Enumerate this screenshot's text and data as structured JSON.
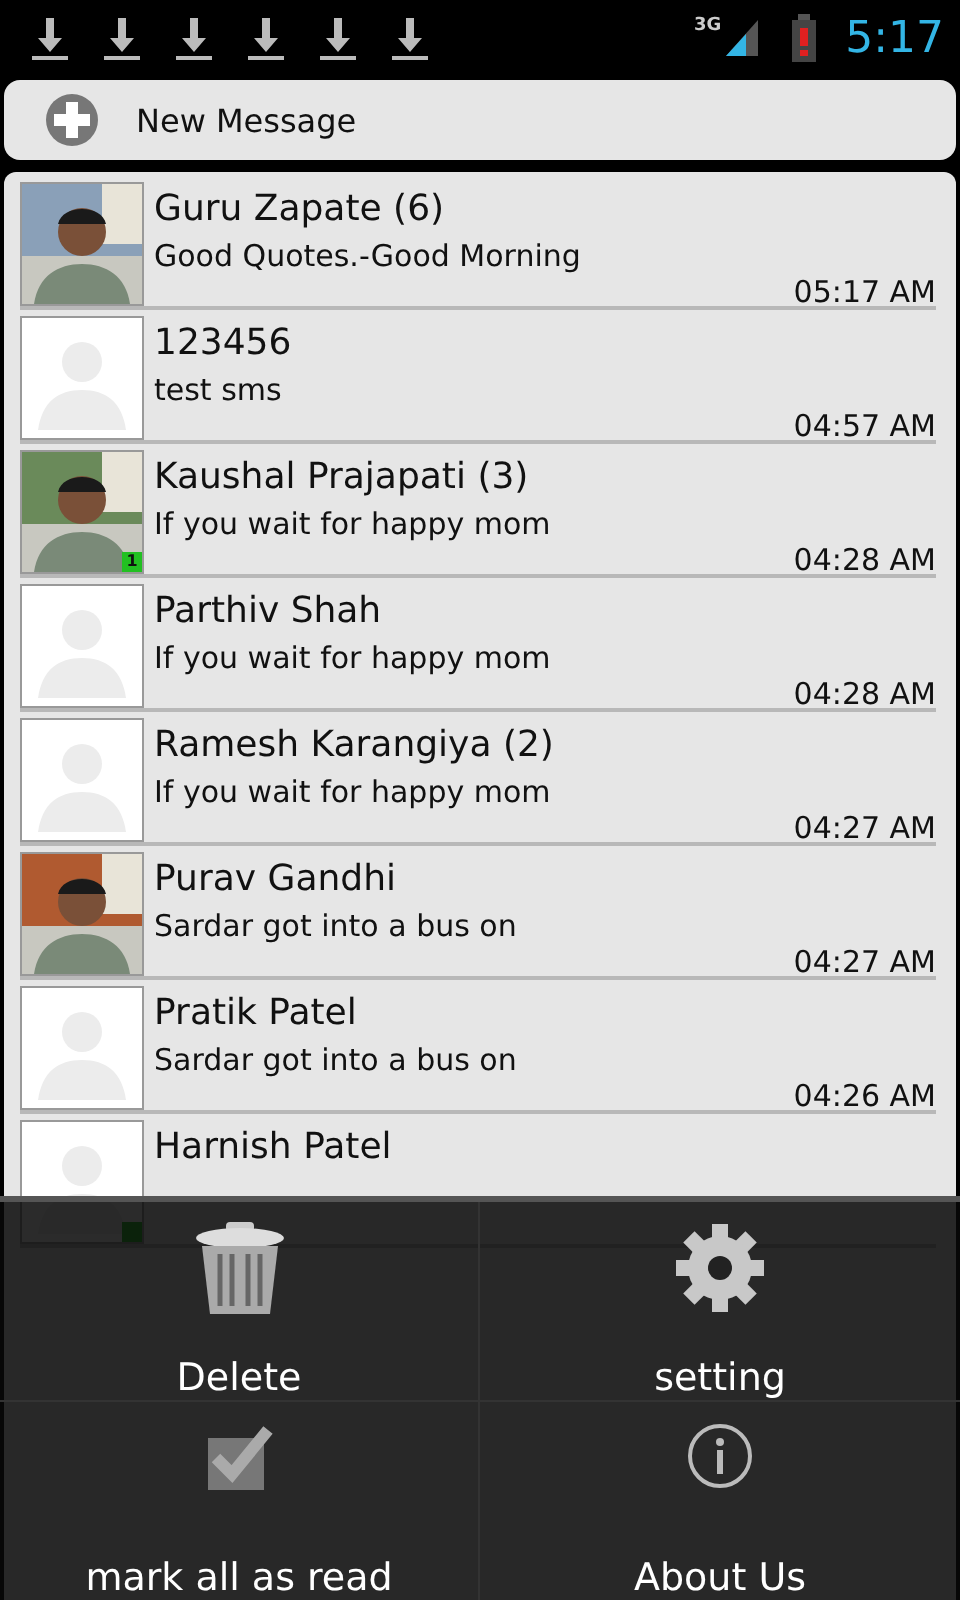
{
  "status_bar": {
    "network": "3G",
    "clock": "5:17"
  },
  "new_message": {
    "label": "New Message"
  },
  "conversations": [
    {
      "name": "Guru Zapate (6)",
      "preview": "Good Quotes.-Good Morning",
      "time": "05:17 AM",
      "presence": false
    },
    {
      "name": "123456",
      "preview": "test sms",
      "time": "04:57 AM",
      "avatar": {
        "kind": "placeholder"
      },
      "presence": false
    },
    {
      "name": "Kaushal Prajapati (3)",
      "preview": "If you wait for happy mom",
      "time": "04:28 AM",
      "presence": true,
      "badge": "1"
    },
    {
      "name": "Parthiv Shah",
      "preview": "If you wait for happy mom",
      "time": "04:28 AM",
      "avatar": {
        "kind": "placeholder"
      },
      "presence": false
    },
    {
      "name": "Ramesh Karangiya (2)",
      "preview": "If you wait for happy mom",
      "time": "04:27 AM",
      "avatar": {
        "kind": "placeholder"
      },
      "presence": false
    },
    {
      "name": "Purav Gandhi",
      "preview": "Sardar got into a bus on",
      "time": "04:27 AM",
      "presence": false
    },
    {
      "name": "Pratik Patel",
      "preview": "Sardar got into a bus on",
      "time": "04:26 AM",
      "avatar": {
        "kind": "placeholder"
      },
      "presence": false
    },
    {
      "name": "Harnish Patel",
      "avatar": {
        "kind": "placeholder"
      },
      "presence": true
    }
  ],
  "menu": [
    {
      "label": "Delete"
    },
    {
      "label": "setting"
    },
    {
      "label": "mark all as read"
    },
    {
      "label": "About Us"
    }
  ]
}
